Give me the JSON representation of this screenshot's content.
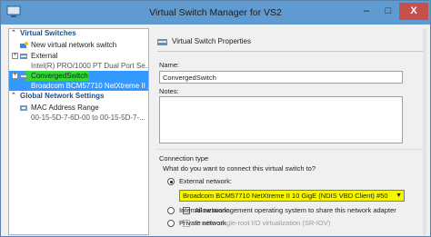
{
  "window": {
    "title": "Virtual Switch Manager for VS2",
    "minimize": "–",
    "maximize": "□",
    "close": "X"
  },
  "tree": {
    "virtual_switches_header": "Virtual Switches",
    "global_settings_header": "Global Network Settings",
    "items": [
      {
        "label": "New virtual network switch"
      },
      {
        "label": "External",
        "sub": "Intel(R) PRO/1000 PT Dual Port Se..."
      },
      {
        "label": "ConvergedSwitch",
        "sub": "Broadcom BCM57710 NetXtreme II ..."
      },
      {
        "label": "MAC Address Range",
        "sub": "00-15-5D-7-6D-00 to 00-15-5D-7-..."
      }
    ]
  },
  "properties": {
    "header": "Virtual Switch Properties",
    "name_label": "Name:",
    "name_value": "ConvergedSwitch",
    "notes_label": "Notes:",
    "notes_value": "",
    "connection_type_label": "Connection type",
    "connection_question": "What do you want to connect this virtual switch to?",
    "external_label": "External network:",
    "adapter_selected": "Broadcom BCM57710 NetXtreme II 10 GigE (NDIS VBD Client) #50",
    "allow_mgmt_label": "Allow management operating system to share this network adapter",
    "sriov_label": "Enable single-root I/O virtualization (SR-IOV)",
    "internal_label": "Internal network",
    "private_label": "Private network"
  },
  "colors": {
    "titlebar": "#5f9bd1",
    "selection": "#3399ff",
    "highlight_green": "#36d63a",
    "highlight_yellow": "#f6f600",
    "close_button": "#c7504a"
  }
}
